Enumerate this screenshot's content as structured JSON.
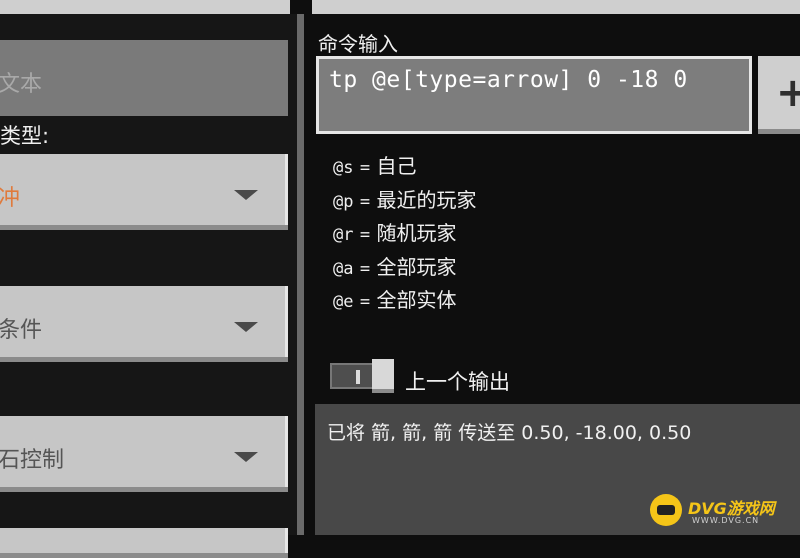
{
  "left_panel": {
    "text_field_placeholder": "文本",
    "type_label": "类型:",
    "type_value": "冲",
    "cond_label": "",
    "cond_value": "条件",
    "redstone_label": "",
    "redstone_value": "石控制"
  },
  "command": {
    "title": "命令输入",
    "value": "tp @e[type=arrow] 0 -18 0",
    "add_label": "+"
  },
  "selectors": [
    {
      "code": "@s",
      "eq": "=",
      "desc": "自己"
    },
    {
      "code": "@p",
      "eq": "=",
      "desc": "最近的玩家"
    },
    {
      "code": "@r",
      "eq": "=",
      "desc": "随机玩家"
    },
    {
      "code": "@a",
      "eq": "=",
      "desc": "全部玩家"
    },
    {
      "code": "@e",
      "eq": "=",
      "desc": "全部实体"
    }
  ],
  "previous_output": {
    "label": "上一个输出",
    "enabled": true,
    "text": "已将 箭, 箭, 箭 传送至 0.50, -18.00, 0.50"
  },
  "watermark": {
    "brand": "DVG游戏网",
    "url": "WWW.DVG.CN"
  },
  "colors": {
    "background": "#0e0e0e",
    "panel_gray": "#c6c6c6",
    "accent_orange": "#e07a3c",
    "watermark_yellow": "#f5c518"
  }
}
